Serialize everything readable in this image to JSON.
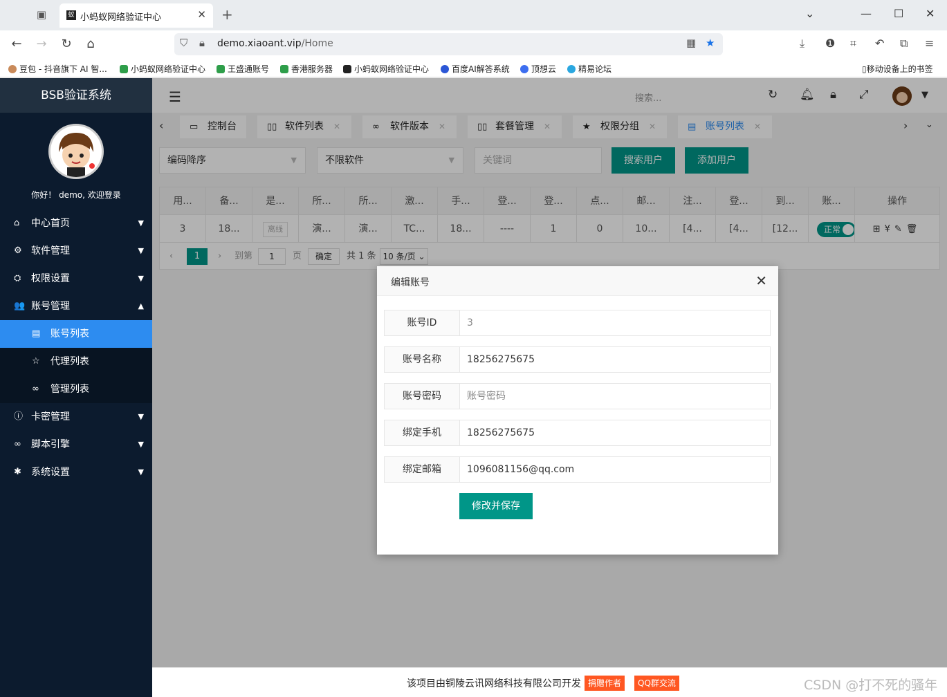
{
  "browser": {
    "tab_title": "小蚂蚁网络验证中心",
    "url_host": "demo.xiaoant.vip",
    "url_path": "/Home",
    "bookmarks": [
      "豆包 - 抖音旗下 AI 智...",
      "小蚂蚁网络验证中心",
      "王盛通账号",
      "香港服务器",
      "小蚂蚁网络验证中心",
      "百度AI解答系统",
      "顶想云",
      "精易论坛"
    ],
    "mobile_bookmarks": "移动设备上的书签"
  },
  "sidebar": {
    "title": "BSB验证系统",
    "welcome": "你好！ demo, 欢迎登录",
    "items": [
      {
        "label": "中心首页",
        "icon": "⌂"
      },
      {
        "label": "软件管理",
        "icon": "⚙"
      },
      {
        "label": "权限设置",
        "icon": "⛭"
      },
      {
        "label": "账号管理",
        "icon": "👥"
      }
    ],
    "sub_items": [
      {
        "label": "账号列表",
        "icon": "▤"
      },
      {
        "label": "代理列表",
        "icon": "☆"
      },
      {
        "label": "管理列表",
        "icon": "∞"
      }
    ],
    "items_after": [
      {
        "label": "卡密管理",
        "icon": "ⓘ"
      },
      {
        "label": "脚本引擎",
        "icon": "∞"
      },
      {
        "label": "系统设置",
        "icon": "✱"
      }
    ]
  },
  "topnav": {
    "search_placeholder": "搜索..."
  },
  "page_tabs": [
    {
      "label": "控制台",
      "icon": "▭"
    },
    {
      "label": "软件列表",
      "icon": "▯▯"
    },
    {
      "label": "软件版本",
      "icon": "∞"
    },
    {
      "label": "套餐管理",
      "icon": "▯▯"
    },
    {
      "label": "权限分组",
      "icon": "★"
    },
    {
      "label": "账号列表",
      "icon": "▤"
    }
  ],
  "filters": {
    "sort": "编码降序",
    "software": "不限软件",
    "keyword_placeholder": "关键词",
    "search_btn": "搜索用户",
    "add_btn": "添加用户"
  },
  "table": {
    "headers": [
      "用...",
      "备...",
      "是...",
      "所...",
      "所...",
      "激...",
      "手...",
      "登...",
      "登...",
      "点...",
      "邮...",
      "注...",
      "登...",
      "到...",
      "账...",
      "操作"
    ],
    "row": [
      "3",
      "18...",
      "离线",
      "演...",
      "演...",
      "TC...",
      "18...",
      "----",
      "1",
      "0",
      "10...",
      "[4...",
      "[4...",
      "[12...",
      "正常",
      ""
    ]
  },
  "pager": {
    "current": "1",
    "goto": "到第",
    "page_input": "1",
    "page_unit": "页",
    "confirm": "确定",
    "total": "共 1 条",
    "per_page": "10 条/页"
  },
  "modal": {
    "title": "编辑账号",
    "fields": [
      {
        "label": "账号ID",
        "value": "3",
        "placeholder": false
      },
      {
        "label": "账号名称",
        "value": "18256275675",
        "placeholder": false
      },
      {
        "label": "账号密码",
        "value": "账号密码",
        "placeholder": true
      },
      {
        "label": "绑定手机",
        "value": "18256275675",
        "placeholder": false
      },
      {
        "label": "绑定邮箱",
        "value": "1096081156@qq.com",
        "placeholder": false
      }
    ],
    "save": "修改并保存"
  },
  "footer": {
    "text": "该项目由铜陵云讯网络科技有限公司开发",
    "donate": "捐赠作者",
    "qq": "QQ群交流"
  },
  "watermark": "CSDN @打不死的骚年"
}
